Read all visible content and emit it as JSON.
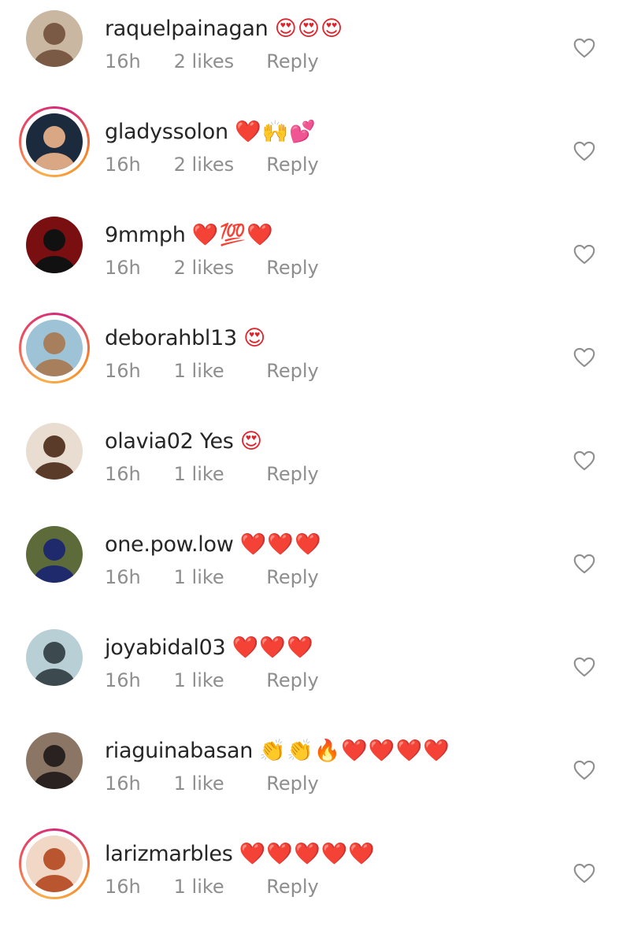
{
  "comments": [
    {
      "username": "raquelpainagan",
      "text": "",
      "emojis": "😍😍😍",
      "time": "16h",
      "likes": "2 likes",
      "reply": "Reply",
      "ring": false,
      "avatar": {
        "bg": "#c9b7a2",
        "fg": "#7a5a44"
      }
    },
    {
      "username": "gladyssolon",
      "text": "",
      "emojis": "❤️🙌💕",
      "time": "16h",
      "likes": "2 likes",
      "reply": "Reply",
      "ring": true,
      "avatar": {
        "bg": "#1c2a3e",
        "fg": "#d9a783"
      }
    },
    {
      "username": "9mmph",
      "text": "",
      "emojis": "❤️💯❤️",
      "time": "16h",
      "likes": "2 likes",
      "reply": "Reply",
      "ring": false,
      "avatar": {
        "bg": "#7a0f12",
        "fg": "#111111"
      }
    },
    {
      "username": "deborahbl13",
      "text": "",
      "emojis": "😍",
      "time": "16h",
      "likes": "1 like",
      "reply": "Reply",
      "ring": true,
      "avatar": {
        "bg": "#9ec3d6",
        "fg": "#a77f5d"
      }
    },
    {
      "username": "olavia02",
      "text": "Yes",
      "emojis": "😍",
      "time": "16h",
      "likes": "1 like",
      "reply": "Reply",
      "ring": false,
      "avatar": {
        "bg": "#e8ddd0",
        "fg": "#5a3a28"
      }
    },
    {
      "username": "one.pow.low",
      "text": "",
      "emojis": "❤️❤️❤️",
      "time": "16h",
      "likes": "1 like",
      "reply": "Reply",
      "ring": false,
      "avatar": {
        "bg": "#5d6b3a",
        "fg": "#1e2a6b"
      }
    },
    {
      "username": "joyabidal03",
      "text": "",
      "emojis": "❤️❤️❤️",
      "time": "16h",
      "likes": "1 like",
      "reply": "Reply",
      "ring": false,
      "avatar": {
        "bg": "#b9cfd6",
        "fg": "#3c4a4f"
      }
    },
    {
      "username": "riaguinabasan",
      "text": "",
      "emojis": "👏👏🔥❤️❤️❤️❤️",
      "time": "16h",
      "likes": "1 like",
      "reply": "Reply",
      "ring": false,
      "avatar": {
        "bg": "#8b7565",
        "fg": "#2a2220"
      }
    },
    {
      "username": "larizmarbles",
      "text": "",
      "emojis": "❤️❤️❤️❤️❤️",
      "time": "16h",
      "likes": "1 like",
      "reply": "Reply",
      "ring": true,
      "avatar": {
        "bg": "#f1d7c6",
        "fg": "#b9562f"
      }
    }
  ],
  "icons": {
    "like": "heart-outline-icon"
  },
  "colors": {
    "text": "#262626",
    "meta": "#8e8e8e",
    "heart": "#8e8e8e"
  }
}
